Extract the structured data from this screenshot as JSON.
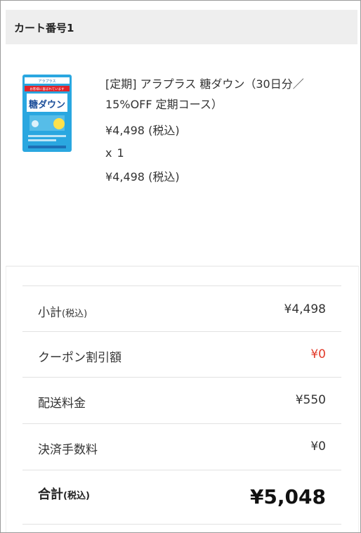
{
  "cart": {
    "title": "カート番号1"
  },
  "product": {
    "name_line1": "[定期] アラプラス 糖ダウン（30日分／",
    "name_line2": "15%OFF 定期コース）",
    "unit_price": "¥4,498 (税込)",
    "quantity": "x  1",
    "subtotal": "¥4,498 (税込)",
    "image": {
      "banner_text": "お客様に喜ばれています",
      "brand": "アラプラス",
      "name": "糖ダウン",
      "badge": "機能性表示食品",
      "colors": {
        "pack": "#2aa7e0",
        "banner": "#e2232a",
        "label": "#ffffff"
      }
    }
  },
  "summary": {
    "subtotal": {
      "label": "小計",
      "tax": "(税込)",
      "value": "¥4,498"
    },
    "coupon": {
      "label": "クーポン割引額",
      "value": "¥0",
      "color": "#e23b2a"
    },
    "shipping": {
      "label": "配送料金",
      "value": "¥550"
    },
    "fee": {
      "label": "決済手数料",
      "value": "¥0"
    },
    "total": {
      "label": "合計",
      "tax": "(税込)",
      "value": "¥5,048"
    }
  }
}
